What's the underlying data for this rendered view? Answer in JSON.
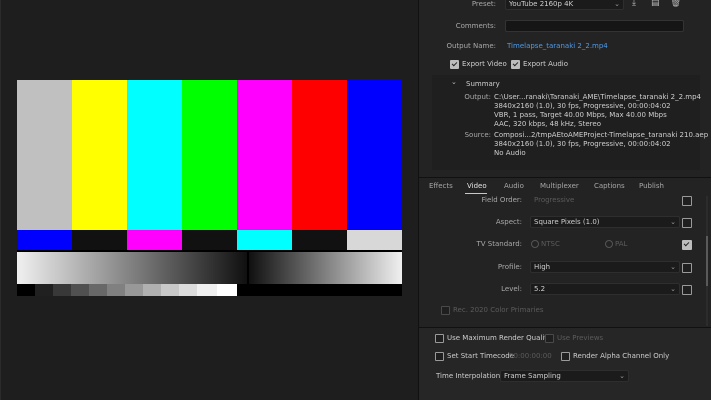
{
  "preset": {
    "label": "Preset:",
    "value": "YouTube 2160p 4K"
  },
  "comments": {
    "label": "Comments:",
    "value": ""
  },
  "output_name": {
    "label": "Output Name:",
    "value": "Timelapse_taranaki 2_2.mp4"
  },
  "export_video": {
    "label": "Export Video",
    "checked": true
  },
  "export_audio": {
    "label": "Export Audio",
    "checked": true
  },
  "summary": {
    "title": "Summary",
    "output_label": "Output:",
    "output_lines": [
      "C:\\User...ranaki\\Taranaki_AME\\Timelapse_taranaki 2_2.mp4",
      "3840x2160 (1.0), 30 fps, Progressive, 00:00:04:02",
      "VBR, 1 pass, Target 40.00 Mbps, Max 40.00 Mbps",
      "AAC, 320 kbps, 48 kHz, Stereo"
    ],
    "source_label": "Source:",
    "source_lines": [
      "Composi...2/tmpAEtoAMEProject-Timelapse_taranaki 210.aep",
      "3840x2160 (1.0), 30 fps, Progressive, 00:00:04:02",
      "No Audio"
    ]
  },
  "tabs": [
    "Effects",
    "Video",
    "Audio",
    "Multiplexer",
    "Captions",
    "Publish"
  ],
  "active_tab": "Video",
  "video": {
    "field_order": {
      "label": "Field Order:",
      "value": "Progressive"
    },
    "aspect": {
      "label": "Aspect:",
      "value": "Square Pixels (1.0)"
    },
    "tv_standard": {
      "label": "TV Standard:",
      "ntsc": "NTSC",
      "pal": "PAL"
    },
    "profile": {
      "label": "Profile:",
      "value": "High"
    },
    "level": {
      "label": "Level:",
      "value": "5.2"
    },
    "rec2020": {
      "label": "Rec. 2020 Color Primaries"
    }
  },
  "bottom": {
    "max_render": {
      "label": "Use Maximum Render Quality"
    },
    "use_previews": {
      "label": "Use Previews"
    },
    "set_start": {
      "label": "Set Start Timecode",
      "timecode": "00:00:00:00"
    },
    "render_alpha": {
      "label": "Render Alpha Channel Only"
    },
    "time_interp": {
      "label": "Time Interpolation:",
      "value": "Frame Sampling"
    }
  },
  "icons": [
    "import-preset-icon",
    "save-preset-icon",
    "delete-preset-icon",
    "collapse-chevron-icon"
  ],
  "colors": {
    "accent": "#4e9bea",
    "panel": "#232323",
    "viewer": "#1e1e1e"
  }
}
